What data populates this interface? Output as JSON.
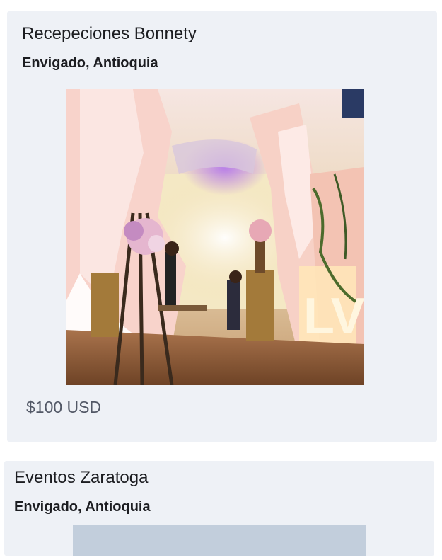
{
  "listings": [
    {
      "name": "Recepeciones Bonnety",
      "location": "Envigado, Antioquia",
      "price": "$100 USD",
      "photo_icon": "venue-photo"
    },
    {
      "name": "Eventos Zaratoga",
      "location": "Envigado, Antioquia",
      "photo_icon": "venue-photo-loading"
    }
  ]
}
